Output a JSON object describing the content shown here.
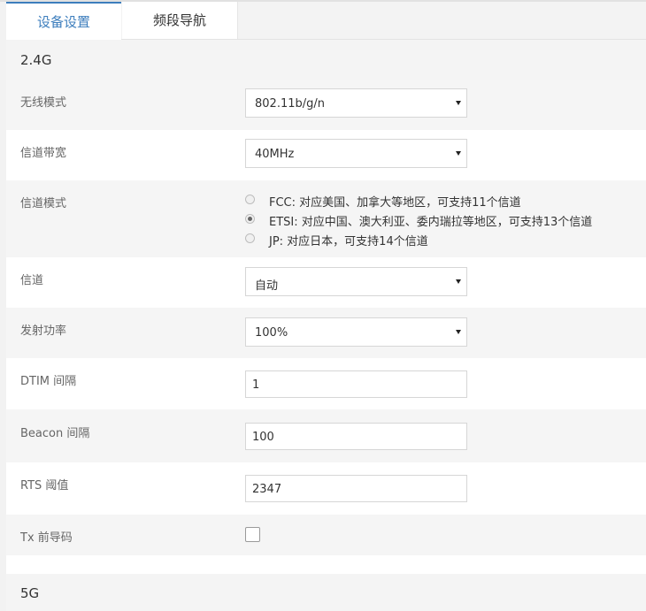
{
  "tabs": [
    {
      "label": "设备设置",
      "active": true
    },
    {
      "label": "频段导航",
      "active": false
    }
  ],
  "section_24": {
    "title": "2.4G"
  },
  "section_5": {
    "title": "5G"
  },
  "fields": {
    "wireless_mode": {
      "label": "无线模式",
      "value": "802.11b/g/n"
    },
    "bandwidth": {
      "label": "信道带宽",
      "value": "40MHz"
    },
    "channel_mode": {
      "label": "信道模式",
      "options": [
        {
          "text": "FCC: 对应美国、加拿大等地区，可支持11个信道",
          "checked": false
        },
        {
          "text": "ETSI: 对应中国、澳大利亚、委内瑞拉等地区，可支持13个信道",
          "checked": true
        },
        {
          "text": "JP: 对应日本，可支持14个信道",
          "checked": false
        }
      ]
    },
    "channel": {
      "label": "信道",
      "value": "自动"
    },
    "tx_power": {
      "label": "发射功率",
      "value": "100%"
    },
    "dtim": {
      "label": "DTIM 间隔",
      "value": "1"
    },
    "beacon": {
      "label": "Beacon 间隔",
      "value": "100"
    },
    "rts": {
      "label": "RTS 阈值",
      "value": "2347"
    },
    "tx_preamble": {
      "label": "Tx 前导码",
      "checked": false
    }
  },
  "colors": {
    "accent": "#3d7ebd",
    "row_shade": "#f5f5f5"
  }
}
